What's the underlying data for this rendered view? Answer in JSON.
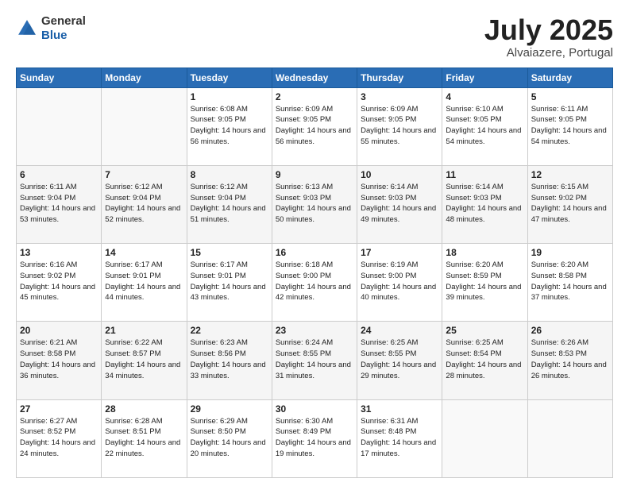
{
  "header": {
    "logo_line1": "General",
    "logo_line2": "Blue",
    "month": "July 2025",
    "location": "Alvaiazere, Portugal"
  },
  "weekdays": [
    "Sunday",
    "Monday",
    "Tuesday",
    "Wednesday",
    "Thursday",
    "Friday",
    "Saturday"
  ],
  "weeks": [
    [
      {
        "day": "",
        "sunrise": "",
        "sunset": "",
        "daylight": ""
      },
      {
        "day": "",
        "sunrise": "",
        "sunset": "",
        "daylight": ""
      },
      {
        "day": "1",
        "sunrise": "Sunrise: 6:08 AM",
        "sunset": "Sunset: 9:05 PM",
        "daylight": "Daylight: 14 hours and 56 minutes."
      },
      {
        "day": "2",
        "sunrise": "Sunrise: 6:09 AM",
        "sunset": "Sunset: 9:05 PM",
        "daylight": "Daylight: 14 hours and 56 minutes."
      },
      {
        "day": "3",
        "sunrise": "Sunrise: 6:09 AM",
        "sunset": "Sunset: 9:05 PM",
        "daylight": "Daylight: 14 hours and 55 minutes."
      },
      {
        "day": "4",
        "sunrise": "Sunrise: 6:10 AM",
        "sunset": "Sunset: 9:05 PM",
        "daylight": "Daylight: 14 hours and 54 minutes."
      },
      {
        "day": "5",
        "sunrise": "Sunrise: 6:11 AM",
        "sunset": "Sunset: 9:05 PM",
        "daylight": "Daylight: 14 hours and 54 minutes."
      }
    ],
    [
      {
        "day": "6",
        "sunrise": "Sunrise: 6:11 AM",
        "sunset": "Sunset: 9:04 PM",
        "daylight": "Daylight: 14 hours and 53 minutes."
      },
      {
        "day": "7",
        "sunrise": "Sunrise: 6:12 AM",
        "sunset": "Sunset: 9:04 PM",
        "daylight": "Daylight: 14 hours and 52 minutes."
      },
      {
        "day": "8",
        "sunrise": "Sunrise: 6:12 AM",
        "sunset": "Sunset: 9:04 PM",
        "daylight": "Daylight: 14 hours and 51 minutes."
      },
      {
        "day": "9",
        "sunrise": "Sunrise: 6:13 AM",
        "sunset": "Sunset: 9:03 PM",
        "daylight": "Daylight: 14 hours and 50 minutes."
      },
      {
        "day": "10",
        "sunrise": "Sunrise: 6:14 AM",
        "sunset": "Sunset: 9:03 PM",
        "daylight": "Daylight: 14 hours and 49 minutes."
      },
      {
        "day": "11",
        "sunrise": "Sunrise: 6:14 AM",
        "sunset": "Sunset: 9:03 PM",
        "daylight": "Daylight: 14 hours and 48 minutes."
      },
      {
        "day": "12",
        "sunrise": "Sunrise: 6:15 AM",
        "sunset": "Sunset: 9:02 PM",
        "daylight": "Daylight: 14 hours and 47 minutes."
      }
    ],
    [
      {
        "day": "13",
        "sunrise": "Sunrise: 6:16 AM",
        "sunset": "Sunset: 9:02 PM",
        "daylight": "Daylight: 14 hours and 45 minutes."
      },
      {
        "day": "14",
        "sunrise": "Sunrise: 6:17 AM",
        "sunset": "Sunset: 9:01 PM",
        "daylight": "Daylight: 14 hours and 44 minutes."
      },
      {
        "day": "15",
        "sunrise": "Sunrise: 6:17 AM",
        "sunset": "Sunset: 9:01 PM",
        "daylight": "Daylight: 14 hours and 43 minutes."
      },
      {
        "day": "16",
        "sunrise": "Sunrise: 6:18 AM",
        "sunset": "Sunset: 9:00 PM",
        "daylight": "Daylight: 14 hours and 42 minutes."
      },
      {
        "day": "17",
        "sunrise": "Sunrise: 6:19 AM",
        "sunset": "Sunset: 9:00 PM",
        "daylight": "Daylight: 14 hours and 40 minutes."
      },
      {
        "day": "18",
        "sunrise": "Sunrise: 6:20 AM",
        "sunset": "Sunset: 8:59 PM",
        "daylight": "Daylight: 14 hours and 39 minutes."
      },
      {
        "day": "19",
        "sunrise": "Sunrise: 6:20 AM",
        "sunset": "Sunset: 8:58 PM",
        "daylight": "Daylight: 14 hours and 37 minutes."
      }
    ],
    [
      {
        "day": "20",
        "sunrise": "Sunrise: 6:21 AM",
        "sunset": "Sunset: 8:58 PM",
        "daylight": "Daylight: 14 hours and 36 minutes."
      },
      {
        "day": "21",
        "sunrise": "Sunrise: 6:22 AM",
        "sunset": "Sunset: 8:57 PM",
        "daylight": "Daylight: 14 hours and 34 minutes."
      },
      {
        "day": "22",
        "sunrise": "Sunrise: 6:23 AM",
        "sunset": "Sunset: 8:56 PM",
        "daylight": "Daylight: 14 hours and 33 minutes."
      },
      {
        "day": "23",
        "sunrise": "Sunrise: 6:24 AM",
        "sunset": "Sunset: 8:55 PM",
        "daylight": "Daylight: 14 hours and 31 minutes."
      },
      {
        "day": "24",
        "sunrise": "Sunrise: 6:25 AM",
        "sunset": "Sunset: 8:55 PM",
        "daylight": "Daylight: 14 hours and 29 minutes."
      },
      {
        "day": "25",
        "sunrise": "Sunrise: 6:25 AM",
        "sunset": "Sunset: 8:54 PM",
        "daylight": "Daylight: 14 hours and 28 minutes."
      },
      {
        "day": "26",
        "sunrise": "Sunrise: 6:26 AM",
        "sunset": "Sunset: 8:53 PM",
        "daylight": "Daylight: 14 hours and 26 minutes."
      }
    ],
    [
      {
        "day": "27",
        "sunrise": "Sunrise: 6:27 AM",
        "sunset": "Sunset: 8:52 PM",
        "daylight": "Daylight: 14 hours and 24 minutes."
      },
      {
        "day": "28",
        "sunrise": "Sunrise: 6:28 AM",
        "sunset": "Sunset: 8:51 PM",
        "daylight": "Daylight: 14 hours and 22 minutes."
      },
      {
        "day": "29",
        "sunrise": "Sunrise: 6:29 AM",
        "sunset": "Sunset: 8:50 PM",
        "daylight": "Daylight: 14 hours and 20 minutes."
      },
      {
        "day": "30",
        "sunrise": "Sunrise: 6:30 AM",
        "sunset": "Sunset: 8:49 PM",
        "daylight": "Daylight: 14 hours and 19 minutes."
      },
      {
        "day": "31",
        "sunrise": "Sunrise: 6:31 AM",
        "sunset": "Sunset: 8:48 PM",
        "daylight": "Daylight: 14 hours and 17 minutes."
      },
      {
        "day": "",
        "sunrise": "",
        "sunset": "",
        "daylight": ""
      },
      {
        "day": "",
        "sunrise": "",
        "sunset": "",
        "daylight": ""
      }
    ]
  ]
}
